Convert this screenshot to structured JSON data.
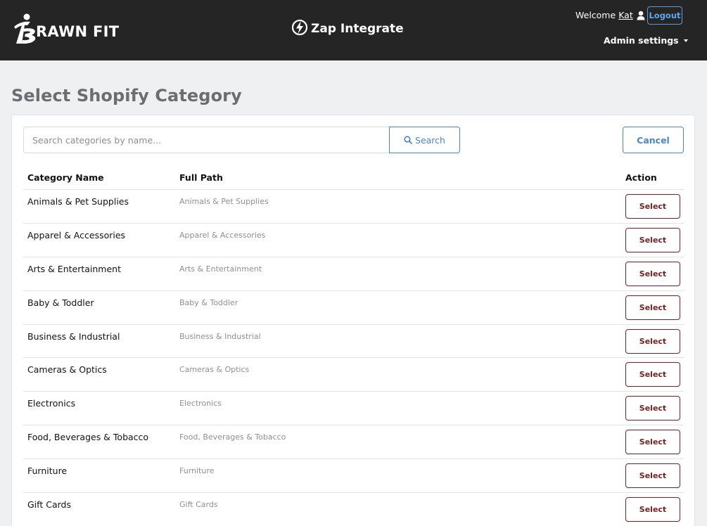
{
  "header": {
    "brand_text": "RAWN FIT",
    "app_name": "Zap Integrate",
    "welcome_label": "Welcome",
    "user_name": "Kat",
    "logout_label": "Logout",
    "admin_settings_label": "Admin settings"
  },
  "page": {
    "title": "Select Shopify Category"
  },
  "search": {
    "placeholder": "Search categories by name...",
    "value": "",
    "button_label": "Search",
    "cancel_label": "Cancel"
  },
  "table": {
    "headers": [
      "Category Name",
      "Full Path",
      "Action"
    ],
    "select_label": "Select",
    "rows": [
      {
        "name": "Animals & Pet Supplies",
        "path": "Animals & Pet Supplies"
      },
      {
        "name": "Apparel & Accessories",
        "path": "Apparel & Accessories"
      },
      {
        "name": "Arts & Entertainment",
        "path": "Arts & Entertainment"
      },
      {
        "name": "Baby & Toddler",
        "path": "Baby & Toddler"
      },
      {
        "name": "Business & Industrial",
        "path": "Business & Industrial"
      },
      {
        "name": "Cameras & Optics",
        "path": "Cameras & Optics"
      },
      {
        "name": "Electronics",
        "path": "Electronics"
      },
      {
        "name": "Food, Beverages & Tobacco",
        "path": "Food, Beverages & Tobacco"
      },
      {
        "name": "Furniture",
        "path": "Furniture"
      },
      {
        "name": "Gift Cards",
        "path": "Gift Cards"
      }
    ]
  },
  "colors": {
    "header_bg": "#252525",
    "accent_blue": "#4a86c5",
    "select_red": "#7a2020",
    "title_gray": "#6a6d72"
  },
  "icons": {
    "brand": "brawn-fit-logo-icon",
    "app": "lightning-bolt-icon",
    "user": "user-icon",
    "search": "search-icon",
    "caret": "caret-down-icon"
  }
}
